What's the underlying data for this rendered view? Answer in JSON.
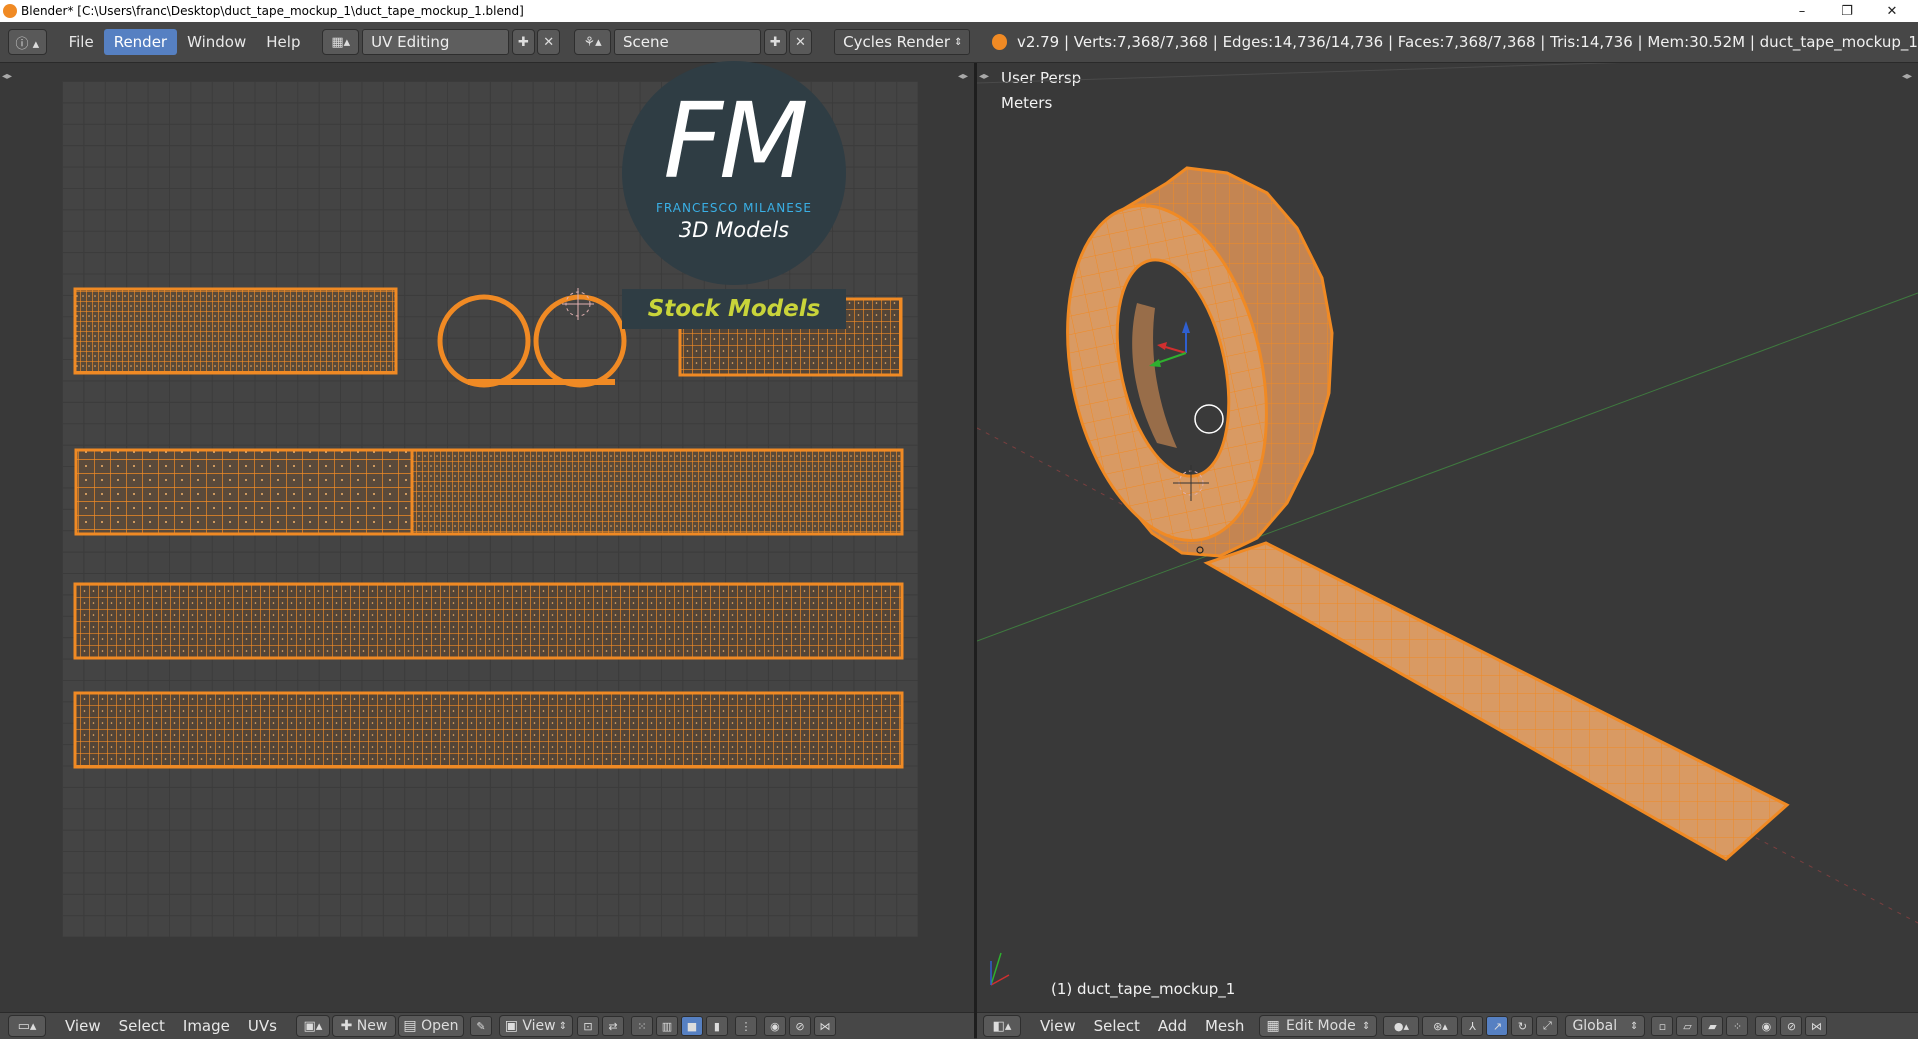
{
  "window": {
    "title": "Blender* [C:\\Users\\franc\\Desktop\\duct_tape_mockup_1\\duct_tape_mockup_1.blend]",
    "controls": {
      "minimize": "–",
      "maximize": "❐",
      "close": "✕"
    }
  },
  "top_menu": {
    "items": [
      "File",
      "Render",
      "Window",
      "Help"
    ],
    "active": "Render",
    "layout": {
      "value": "UV Editing"
    },
    "scene": {
      "value": "Scene"
    },
    "engine": {
      "value": "Cycles Render"
    },
    "stats": "v2.79 | Verts:7,368/7,368 | Edges:14,736/14,736 | Faces:7,368/7,368 | Tris:14,736 | Mem:30.52M | duct_tape_mockup_1"
  },
  "watermark": {
    "monogram": "FM",
    "line1": "FRANCESCO MILANESE",
    "line2": "3D Models",
    "banner": "Stock Models"
  },
  "viewport": {
    "view_label": "User Persp",
    "units_label": "Meters",
    "object_label": "(1) duct_tape_mockup_1"
  },
  "uv_header": {
    "items": [
      "View",
      "Select",
      "Image",
      "UVs"
    ],
    "new_label": "New",
    "open_label": "Open",
    "view_label": "View"
  },
  "vp_header": {
    "items": [
      "View",
      "Select",
      "Add",
      "Mesh"
    ],
    "mode": "Edit Mode",
    "orientation": "Global"
  },
  "colors": {
    "accent": "#5680c2",
    "selection": "#f08a24",
    "banner_text": "#c9d43a"
  }
}
